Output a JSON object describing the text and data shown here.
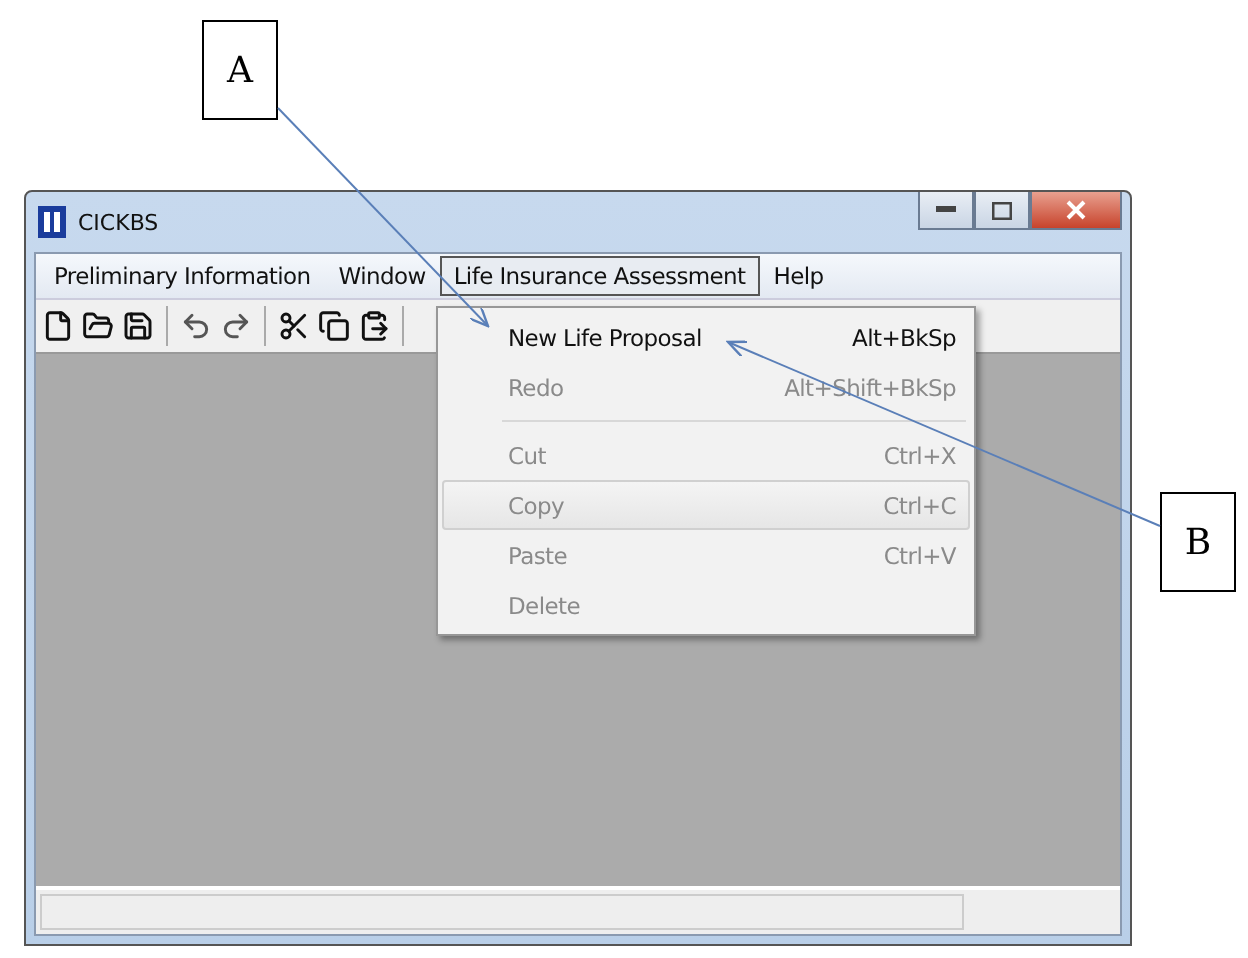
{
  "window": {
    "title": "CICKBS"
  },
  "menubar": [
    {
      "label": "Preliminary Information",
      "selected": false
    },
    {
      "label": "Window",
      "selected": false
    },
    {
      "label": "Life Insurance Assessment",
      "selected": true
    },
    {
      "label": "Help",
      "selected": false
    }
  ],
  "dropdown": [
    {
      "kind": "item",
      "label": "New Life Proposal",
      "shortcut": "Alt+BkSp",
      "disabled": false,
      "selected": false
    },
    {
      "kind": "item",
      "label": "Redo",
      "shortcut": "Alt+Shift+BkSp",
      "disabled": true,
      "selected": false
    },
    {
      "kind": "separator"
    },
    {
      "kind": "item",
      "label": "Cut",
      "shortcut": "Ctrl+X",
      "disabled": true,
      "selected": false
    },
    {
      "kind": "item",
      "label": "Copy",
      "shortcut": "Ctrl+C",
      "disabled": true,
      "selected": true
    },
    {
      "kind": "item",
      "label": "Paste",
      "shortcut": "Ctrl+V",
      "disabled": true,
      "selected": false
    },
    {
      "kind": "item",
      "label": "Delete",
      "disabled": true,
      "selected": false
    }
  ],
  "annotations": [
    {
      "label": "A"
    },
    {
      "label": "B"
    }
  ]
}
